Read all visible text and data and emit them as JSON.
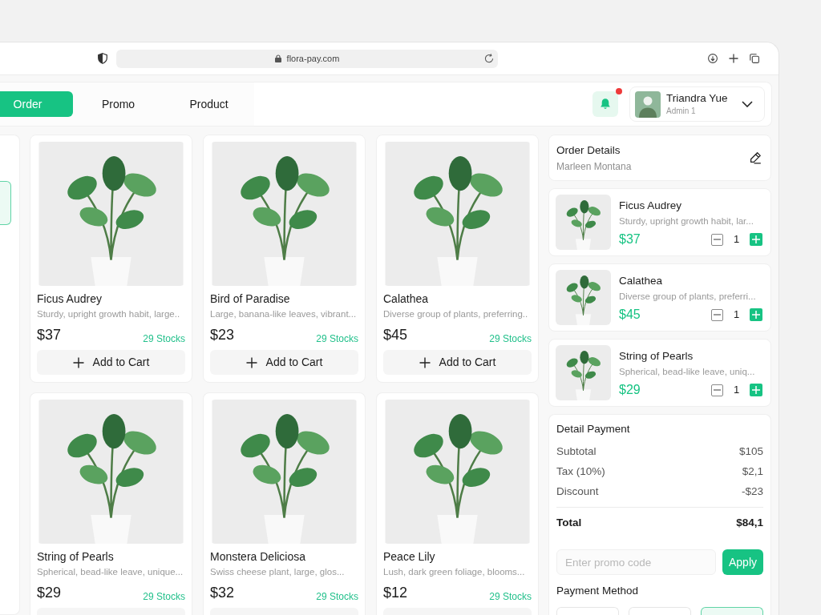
{
  "browser": {
    "url": "flora-pay.com"
  },
  "header": {
    "tabs": [
      {
        "label": "Order",
        "selected": true
      },
      {
        "label": "Promo",
        "selected": false
      },
      {
        "label": "Product",
        "selected": false
      }
    ],
    "notification": {
      "unread": true
    },
    "user": {
      "name": "Triandra Yue",
      "role": "Admin 1"
    }
  },
  "left_panel": {
    "items": [
      {
        "selected": true
      }
    ]
  },
  "products": [
    {
      "name": "Ficus Audrey",
      "description": "Sturdy, upright growth habit, large..",
      "price": "$37",
      "stock": "29 Stocks",
      "button": "Add to Cart"
    },
    {
      "name": "Bird of Paradise",
      "description": "Large, banana-like leaves, vibrant...",
      "price": "$23",
      "stock": "29 Stocks",
      "button": "Add to Cart"
    },
    {
      "name": "Calathea",
      "description": "Diverse group of plants, preferring..",
      "price": "$45",
      "stock": "29 Stocks",
      "button": "Add to Cart"
    },
    {
      "name": "String of Pearls",
      "description": "Spherical, bead-like leave, unique...",
      "price": "$29",
      "stock": "29 Stocks"
    },
    {
      "name": "Monstera Deliciosa",
      "description": "Swiss cheese plant, large, glos...",
      "price": "$32",
      "stock": "29 Stocks"
    },
    {
      "name": "Peace Lily",
      "description": "Lush, dark green foliage, blooms...",
      "price": "$12",
      "stock": "29 Stocks"
    }
  ],
  "order": {
    "title": "Order Details",
    "customer": "Marleen Montana",
    "items": [
      {
        "name": "Ficus Audrey",
        "description": "Sturdy, upright growth habit, lar...",
        "price": "$37",
        "quantity": "1"
      },
      {
        "name": "Calathea",
        "description": "Diverse group of plants, preferri...",
        "price": "$45",
        "quantity": "1"
      },
      {
        "name": "String of Pearls",
        "description": "Spherical, bead-like leave, uniq...",
        "price": "$29",
        "quantity": "1"
      }
    ]
  },
  "payment": {
    "title": "Detail Payment",
    "rows": [
      {
        "label": "Subtotal",
        "value": "$105"
      },
      {
        "label": "Tax (10%)",
        "value": "$2,1"
      },
      {
        "label": "Discount",
        "value": "-$23"
      }
    ],
    "total": {
      "label": "Total",
      "value": "$84,1"
    },
    "promo": {
      "placeholder": "Enter promo code",
      "button": "Apply"
    },
    "method_title": "Payment Method",
    "methods": [
      {
        "selected": false
      },
      {
        "selected": false
      },
      {
        "selected": true
      }
    ]
  }
}
